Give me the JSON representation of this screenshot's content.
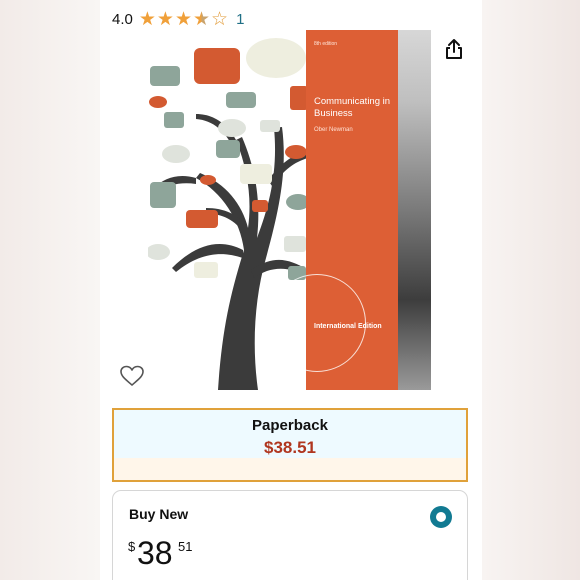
{
  "rating": {
    "value": "4.0",
    "stars": 4,
    "count": "1"
  },
  "cover": {
    "edition": "8th edition",
    "title": "Communicating in Business",
    "authors": "Ober Newman",
    "badge": "International Edition"
  },
  "format": {
    "label": "Paperback",
    "price": "$38.51"
  },
  "buy_option": {
    "title": "Buy New",
    "price_symbol": "$",
    "price_whole": "38",
    "price_fraction": "51"
  },
  "colors": {
    "star": "#f0a03a",
    "link": "#1f6f86",
    "price": "#b0361f",
    "format_border": "#e0a13a",
    "radio": "#117a92",
    "cover_panel": "#dd5f35"
  },
  "icons": {
    "share": "share-icon",
    "wishlist": "heart-icon",
    "star": "star-icon",
    "radio": "radio-selected-icon"
  }
}
